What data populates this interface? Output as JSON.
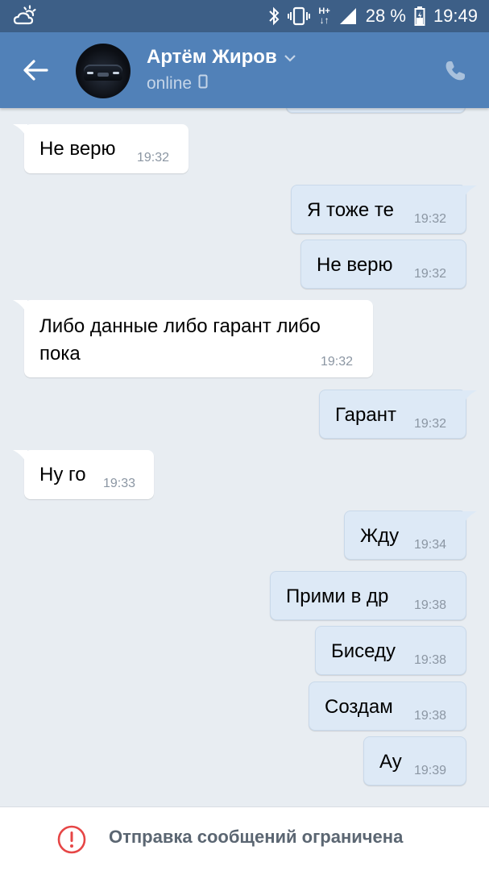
{
  "status_bar": {
    "battery_percent": "28 %",
    "time": "19:49",
    "network_label": "H+",
    "icons": [
      "weather-icon",
      "bluetooth-icon",
      "vibrate-icon",
      "network-icon",
      "signal-icon",
      "battery-icon"
    ]
  },
  "header": {
    "contact_name": "Артём Жиров",
    "status": "online",
    "colors": {
      "bar": "#5181b8",
      "status_bar": "#3d5f87"
    }
  },
  "messages": [
    {
      "side": "in",
      "text": "Не верю",
      "time": "19:32"
    },
    {
      "side": "out",
      "text": "Я тоже те",
      "time": "19:32"
    },
    {
      "side": "out",
      "text": "Не верю",
      "time": "19:32"
    },
    {
      "side": "in",
      "text_lines": [
        "Либо данные либо гарант либо",
        "пока"
      ],
      "time": "19:32"
    },
    {
      "side": "out",
      "text": "Гарант",
      "time": "19:32"
    },
    {
      "side": "in",
      "text": "Ну го",
      "time": "19:33"
    },
    {
      "side": "out",
      "text": "Жду",
      "time": "19:34"
    },
    {
      "side": "out",
      "text": "Прими в др",
      "time": "19:38"
    },
    {
      "side": "out",
      "text": "Биседу",
      "time": "19:38"
    },
    {
      "side": "out",
      "text": "Создам",
      "time": "19:38"
    },
    {
      "side": "out",
      "text": "Ау",
      "time": "19:39"
    }
  ],
  "footer": {
    "notice": "Отправка сообщений ограничена",
    "accent": "#e64646"
  }
}
